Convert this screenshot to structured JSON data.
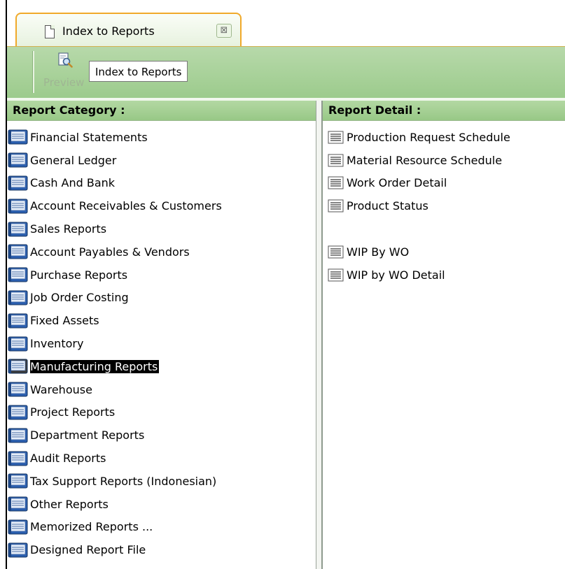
{
  "tab": {
    "title": "Index to Reports",
    "close_glyph": "⊠"
  },
  "toolbar": {
    "preview_label": "Preview",
    "tooltip": "Index to Reports"
  },
  "category_panel": {
    "header": "Report Category :",
    "items": [
      {
        "label": "Financial Statements"
      },
      {
        "label": "General Ledger"
      },
      {
        "label": "Cash And Bank"
      },
      {
        "label": "Account Receivables & Customers"
      },
      {
        "label": "Sales Reports"
      },
      {
        "label": "Account Payables & Vendors"
      },
      {
        "label": "Purchase Reports"
      },
      {
        "label": "Job Order Costing"
      },
      {
        "label": "Fixed Assets"
      },
      {
        "label": "Inventory"
      },
      {
        "label": "Manufacturing Reports",
        "selected": true
      },
      {
        "label": "Warehouse"
      },
      {
        "label": "Project Reports"
      },
      {
        "label": "Department Reports"
      },
      {
        "label": "Audit Reports"
      },
      {
        "label": "Tax Support Reports (Indonesian)"
      },
      {
        "label": "Other Reports"
      },
      {
        "label": "Memorized Reports ..."
      },
      {
        "label": "Designed Report File"
      }
    ]
  },
  "detail_panel": {
    "header": "Report Detail :",
    "items": [
      {
        "label": "Production Request Schedule"
      },
      {
        "label": "Material Resource Schedule"
      },
      {
        "label": "Work Order Detail"
      },
      {
        "label": "Product Status"
      },
      {
        "label": "WIP By WO"
      },
      {
        "label": "WIP by WO Detail"
      }
    ]
  },
  "icons": {
    "category": "report-book-icon",
    "detail": "report-document-icon",
    "tab": "document-icon",
    "preview": "preview-magnifier-icon",
    "close": "close-icon"
  },
  "colors": {
    "accent_green": "#9ccb8c",
    "tab_border": "#f0a92a",
    "selected_bg": "#000000",
    "selected_text": "#ffffff"
  }
}
